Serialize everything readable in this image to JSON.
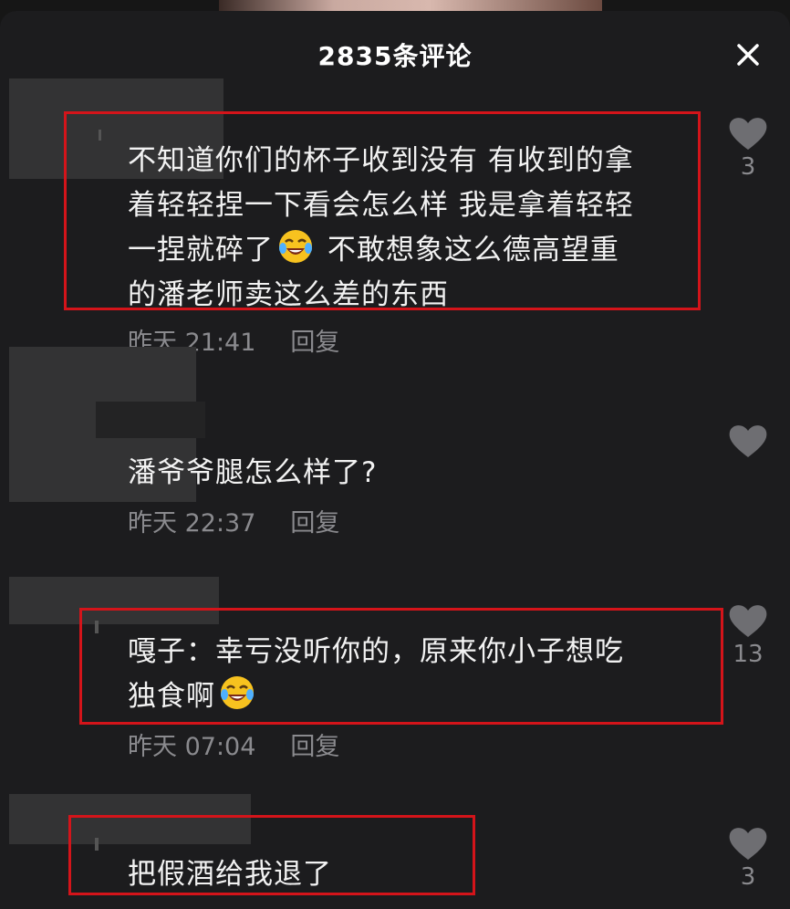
{
  "header": {
    "title": "2835条评论"
  },
  "comments": [
    {
      "lines": [
        "不知道你们的杯子收到没有 有收到的拿",
        "着轻轻捏一下看会怎么样 我是拿着轻轻",
        "一捏就碎了",
        " 不敢想象这么德高望重",
        "的潘老师卖这么差的东西"
      ],
      "emoji": "laughing-crying-emoji",
      "time": "昨天 21:41",
      "reply": "回复",
      "likes": "3"
    },
    {
      "lines": [
        "潘爷爷腿怎么样了?"
      ],
      "time": "昨天 22:37",
      "reply": "回复",
      "likes": ""
    },
    {
      "lines": [
        "嘎子：幸亏没听你的，原来你小子想吃",
        "独食啊"
      ],
      "emoji": "laughing-crying-emoji",
      "time": "昨天 07:04",
      "reply": "回复",
      "likes": "13"
    },
    {
      "lines": [
        "把假酒给我退了"
      ],
      "likes": "3"
    }
  ],
  "colors": {
    "highlight": "#d4141a",
    "text": "#f2f2f2",
    "meta": "#8a8a8e"
  },
  "icons": {
    "close": "close-icon",
    "like": "heart-icon"
  }
}
